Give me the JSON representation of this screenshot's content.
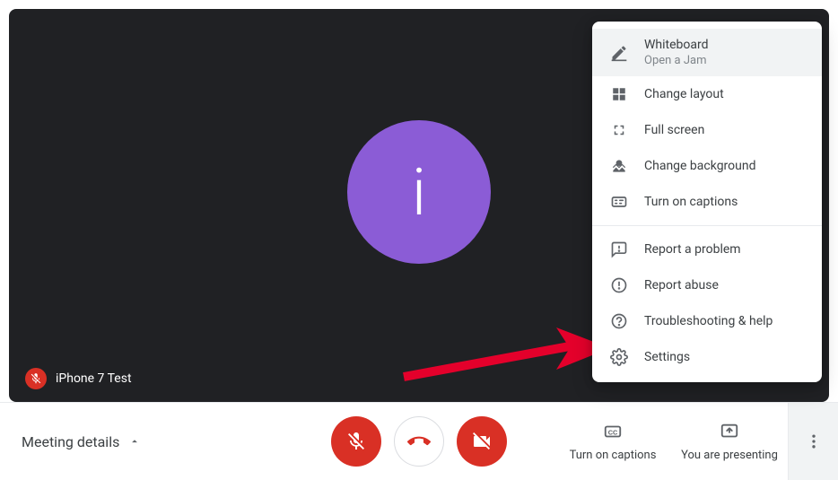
{
  "participant": {
    "name": "iPhone 7 Test",
    "avatar_letter": "i"
  },
  "menu": {
    "whiteboard": {
      "title": "Whiteboard",
      "subtitle": "Open a Jam"
    },
    "change_layout": "Change layout",
    "full_screen": "Full screen",
    "change_background": "Change background",
    "turn_on_captions": "Turn on captions",
    "report_problem": "Report a problem",
    "report_abuse": "Report abuse",
    "troubleshooting": "Troubleshooting & help",
    "settings": "Settings"
  },
  "bottom": {
    "meeting_details": "Meeting details",
    "captions_label": "Turn on captions",
    "presenting_label": "You are presenting"
  }
}
